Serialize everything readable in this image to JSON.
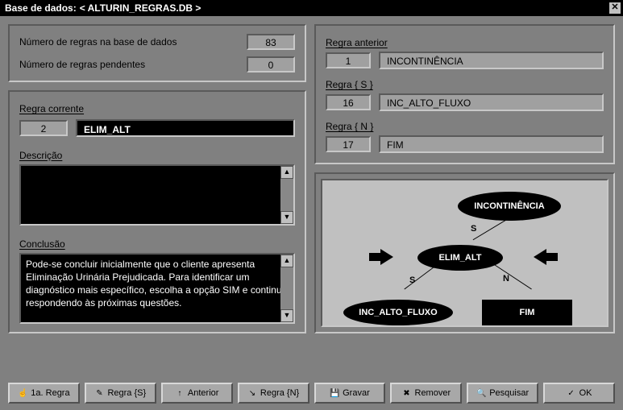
{
  "title_prefix": "Base de dados:  ",
  "title_db": "< ALTURIN_REGRAS.DB >",
  "stats": {
    "rules_label": "Número de regras na base de  dados",
    "rules_value": "83",
    "pending_label": "Número de regras pendentes",
    "pending_value": "0"
  },
  "current": {
    "heading": "Regra corrente",
    "id": "2",
    "name": "ELIM_ALT",
    "desc_heading": "Descrição",
    "desc_text": "",
    "conc_heading": "Conclusão",
    "conc_text": "Pode-se concluir inicialmente que o cliente apresenta Eliminação Urinária Prejudicada. Para identificar um diagnóstico mais específico,  escolha a opção SIM e continue respondendo às próximas questões."
  },
  "links": {
    "prev_heading": "Regra anterior",
    "prev_id": "1",
    "prev_name": "INCONTINÊNCIA",
    "s_heading": "Regra { S }",
    "s_id": "16",
    "s_name": "INC_ALTO_FLUXO",
    "n_heading": "Regra { N }",
    "n_id": "17",
    "n_name": "FIM"
  },
  "diagram": {
    "top": "INCONTINÊNCIA",
    "center": "ELIM_ALT",
    "left": "INC_ALTO_FLUXO",
    "right": "FIM",
    "edge_top": "S",
    "edge_left": "S",
    "edge_right": "N"
  },
  "buttons": {
    "first": "1a. Regra",
    "s": "Regra {S}",
    "prev": "Anterior",
    "n": "Regra {N}",
    "save": "Gravar",
    "remove": "Remover",
    "search": "Pesquisar",
    "ok": "OK"
  }
}
